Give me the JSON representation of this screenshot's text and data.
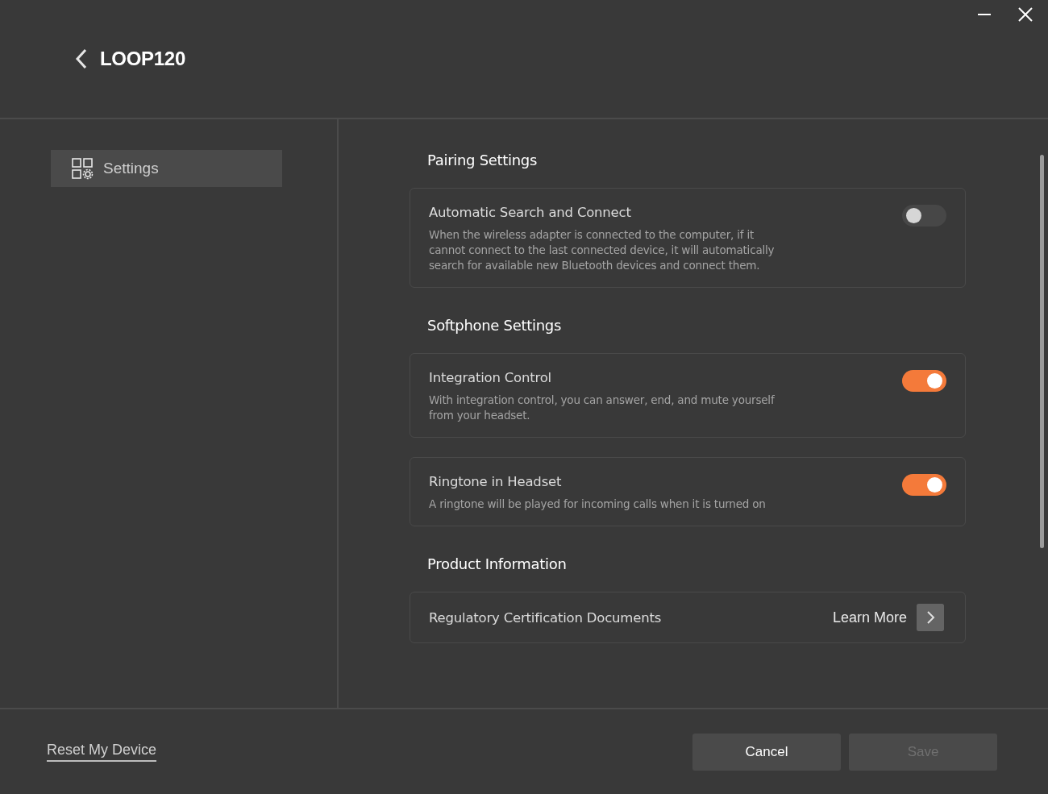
{
  "window": {
    "title": "LOOP120"
  },
  "sidebar": {
    "items": [
      {
        "label": "Settings",
        "selected": true
      }
    ]
  },
  "sections": [
    {
      "heading": "Pairing Settings",
      "items": [
        {
          "kind": "toggle",
          "title": "Automatic Search and Connect",
          "description": "When the wireless adapter is connected to the computer, if it cannot connect to the last connected device, it will automatically search for available new Bluetooth devices and connect them.",
          "on": false
        }
      ]
    },
    {
      "heading": "Softphone Settings",
      "items": [
        {
          "kind": "toggle",
          "title": "Integration Control",
          "description": "With integration control, you can answer, end, and mute yourself from your headset.",
          "on": true
        },
        {
          "kind": "toggle",
          "title": "Ringtone in Headset",
          "description": "A ringtone will be played for incoming calls when it is turned on",
          "on": true
        }
      ]
    },
    {
      "heading": "Product Information",
      "items": [
        {
          "kind": "link",
          "title": "Regulatory Certification Documents",
          "link": "Learn More"
        }
      ]
    }
  ],
  "footer": {
    "reset_link": "Reset My Device",
    "buttons": [
      {
        "label": "Cancel",
        "disabled": false
      },
      {
        "label": "Save",
        "disabled": true
      }
    ]
  }
}
